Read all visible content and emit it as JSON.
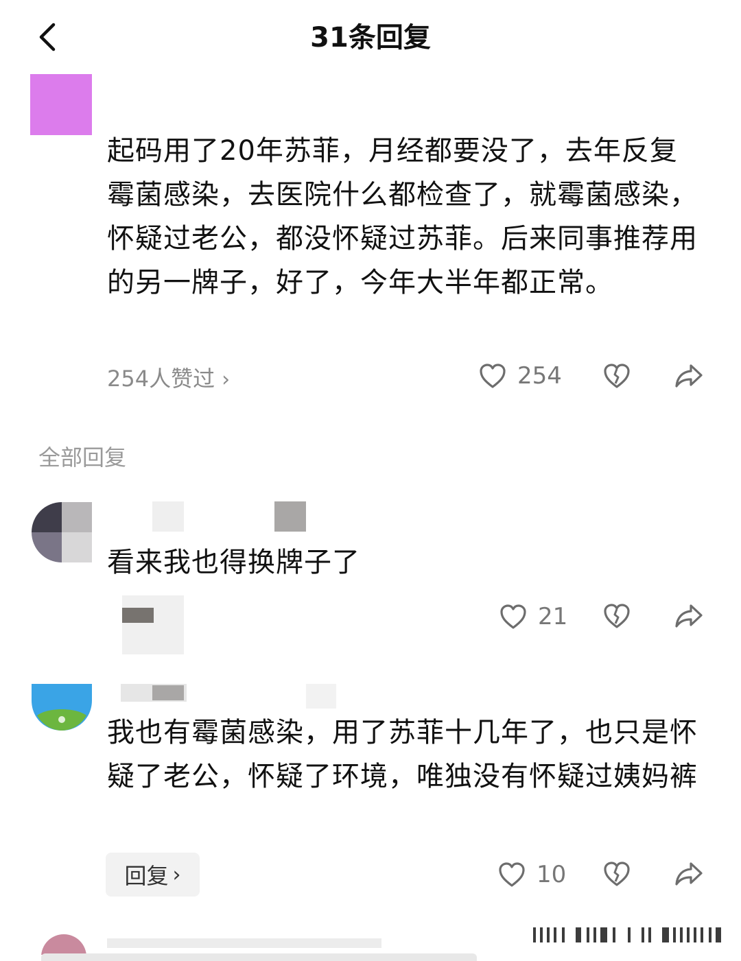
{
  "header": {
    "title": "31条回复"
  },
  "main_comment": {
    "text": "起码用了20年苏菲，月经都要没了，去年反复霉菌感染，去医院什么都检查了，就霉菌感染，怀疑过老公，都没怀疑过苏菲。后来同事推荐用的另一牌子，好了，今年大半年都正常。",
    "likes_summary": "254人赞过",
    "like_count": "254"
  },
  "section": {
    "label": "全部回复"
  },
  "replies": [
    {
      "text": "看来我也得换牌子了",
      "like_count": "21"
    },
    {
      "text": "我也有霉菌感染，用了苏菲十几年了，也只是怀疑了老公，怀疑了环境，唯独没有怀疑过姨妈裤",
      "reply_button": "回复",
      "like_count": "10"
    }
  ],
  "colors": {
    "avatar_main": "#dc7cec",
    "text_primary": "#111111",
    "text_secondary": "#8a8a8a",
    "icon": "#6d6d6d"
  }
}
